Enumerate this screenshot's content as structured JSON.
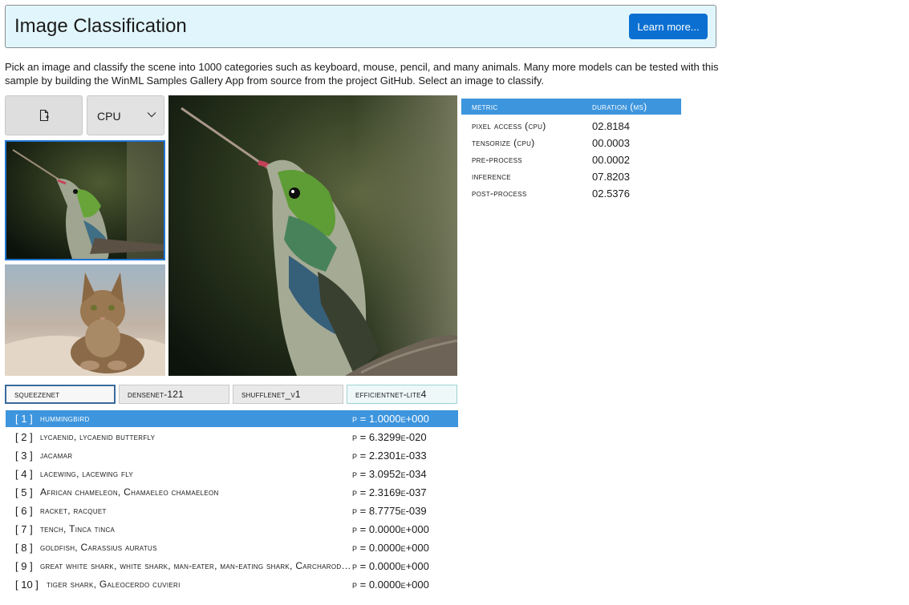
{
  "header": {
    "title": "Image Classification",
    "learn_more": "Learn more..."
  },
  "description": "Pick an image and classify the scene into 1000 categories such as keyboard, mouse, pencil, and many animals. Many more models can be tested with this sample by building the WinML Samples Gallery App from source from the project GitHub. Select an image to classify.",
  "device": {
    "selected": "CPU"
  },
  "models": [
    "squeezenet",
    "densenet-121",
    "shufflenet_v1",
    "efficientnet-lite4"
  ],
  "predictions": [
    {
      "index": "[ 1 ]",
      "label": "hummingbird",
      "prob": "p = 1.0000e+000"
    },
    {
      "index": "[ 2 ]",
      "label": "lycaenid, lycaenid butterfly",
      "prob": "p = 6.3299e-020"
    },
    {
      "index": "[ 3 ]",
      "label": "jacamar",
      "prob": "p = 2.2301e-033"
    },
    {
      "index": "[ 4 ]",
      "label": "lacewing, lacewing fly",
      "prob": "p = 3.0952e-034"
    },
    {
      "index": "[ 5 ]",
      "label": "African chameleon, Chamaeleo chamaeleon",
      "prob": "p = 2.3169e-037"
    },
    {
      "index": "[ 6 ]",
      "label": "racket, racquet",
      "prob": "p = 8.7775e-039"
    },
    {
      "index": "[ 7 ]",
      "label": "tench, Tinca tinca",
      "prob": "p = 0.0000e+000"
    },
    {
      "index": "[ 8 ]",
      "label": "goldfish, Carassius auratus",
      "prob": "p = 0.0000e+000"
    },
    {
      "index": "[ 9 ]",
      "label": "great white shark, white shark, man-eater, man-eating shark, Carcharodon carcharias",
      "prob": "p = 0.0000e+000"
    },
    {
      "index": "[ 10 ]",
      "label": "tiger shark, Galeocerdo cuvieri",
      "prob": "p = 0.0000e+000"
    }
  ],
  "metrics": {
    "header": {
      "metric": "metric",
      "duration": "duration (ms)"
    },
    "rows": [
      {
        "name": "pixel access (cpu)",
        "value": "02.8184"
      },
      {
        "name": "tensorize (cpu)",
        "value": "00.0003"
      },
      {
        "name": "pre-process",
        "value": "00.0002"
      },
      {
        "name": "inference",
        "value": "07.8203"
      },
      {
        "name": "post-process",
        "value": "02.5376"
      }
    ]
  },
  "icons": {
    "file_button": "open-file-icon",
    "dropdown": "chevron-down-icon"
  },
  "colors": {
    "accent": "#0a6fd1",
    "selection": "#3d95dd",
    "header_bg": "#e1f6fc"
  }
}
